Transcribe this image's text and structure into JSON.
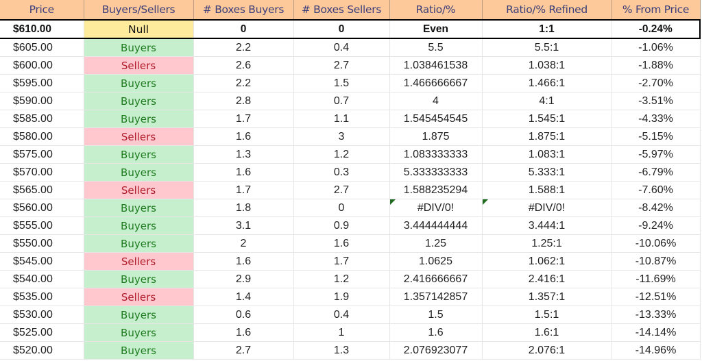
{
  "headers": [
    "Price",
    "Buyers/Sellers",
    "# Boxes Buyers",
    "# Boxes Sellers",
    "Ratio/%",
    "Ratio/% Refined",
    "% From Price"
  ],
  "colors": {
    "header_bg": "#fdc99a",
    "header_text": "#3d3f7a",
    "buyers_bg": "#c6efce",
    "buyers_text": "#1e7b1e",
    "sellers_bg": "#ffc7ce",
    "sellers_text": "#b01c2a",
    "null_bg": "#ffeb9c",
    "null_text": "#9c5a00"
  },
  "current_row": {
    "price": "$610.00",
    "side": "Null",
    "boxes_buyers": "0",
    "boxes_sellers": "0",
    "ratio": "Even",
    "ratio_refined": "1:1",
    "pct_from_price": "-0.24%"
  },
  "rows": [
    {
      "price": "$605.00",
      "side": "Buyers",
      "boxes_buyers": "2.2",
      "boxes_sellers": "0.4",
      "ratio": "5.5",
      "ratio_refined": "5.5:1",
      "pct_from_price": "-1.06%"
    },
    {
      "price": "$600.00",
      "side": "Sellers",
      "boxes_buyers": "2.6",
      "boxes_sellers": "2.7",
      "ratio": "1.038461538",
      "ratio_refined": "1.038:1",
      "pct_from_price": "-1.88%"
    },
    {
      "price": "$595.00",
      "side": "Buyers",
      "boxes_buyers": "2.2",
      "boxes_sellers": "1.5",
      "ratio": "1.466666667",
      "ratio_refined": "1.466:1",
      "pct_from_price": "-2.70%"
    },
    {
      "price": "$590.00",
      "side": "Buyers",
      "boxes_buyers": "2.8",
      "boxes_sellers": "0.7",
      "ratio": "4",
      "ratio_refined": "4:1",
      "pct_from_price": "-3.51%"
    },
    {
      "price": "$585.00",
      "side": "Buyers",
      "boxes_buyers": "1.7",
      "boxes_sellers": "1.1",
      "ratio": "1.545454545",
      "ratio_refined": "1.545:1",
      "pct_from_price": "-4.33%"
    },
    {
      "price": "$580.00",
      "side": "Sellers",
      "boxes_buyers": "1.6",
      "boxes_sellers": "3",
      "ratio": "1.875",
      "ratio_refined": "1.875:1",
      "pct_from_price": "-5.15%"
    },
    {
      "price": "$575.00",
      "side": "Buyers",
      "boxes_buyers": "1.3",
      "boxes_sellers": "1.2",
      "ratio": "1.083333333",
      "ratio_refined": "1.083:1",
      "pct_from_price": "-5.97%"
    },
    {
      "price": "$570.00",
      "side": "Buyers",
      "boxes_buyers": "1.6",
      "boxes_sellers": "0.3",
      "ratio": "5.333333333",
      "ratio_refined": "5.333:1",
      "pct_from_price": "-6.79%"
    },
    {
      "price": "$565.00",
      "side": "Sellers",
      "boxes_buyers": "1.7",
      "boxes_sellers": "2.7",
      "ratio": "1.588235294",
      "ratio_refined": "1.588:1",
      "pct_from_price": "-7.60%"
    },
    {
      "price": "$560.00",
      "side": "Buyers",
      "boxes_buyers": "1.8",
      "boxes_sellers": "0",
      "ratio": "#DIV/0!",
      "ratio_refined": "#DIV/0!",
      "pct_from_price": "-8.42%",
      "error_flag": true
    },
    {
      "price": "$555.00",
      "side": "Buyers",
      "boxes_buyers": "3.1",
      "boxes_sellers": "0.9",
      "ratio": "3.444444444",
      "ratio_refined": "3.444:1",
      "pct_from_price": "-9.24%"
    },
    {
      "price": "$550.00",
      "side": "Buyers",
      "boxes_buyers": "2",
      "boxes_sellers": "1.6",
      "ratio": "1.25",
      "ratio_refined": "1.25:1",
      "pct_from_price": "-10.06%"
    },
    {
      "price": "$545.00",
      "side": "Sellers",
      "boxes_buyers": "1.6",
      "boxes_sellers": "1.7",
      "ratio": "1.0625",
      "ratio_refined": "1.062:1",
      "pct_from_price": "-10.87%"
    },
    {
      "price": "$540.00",
      "side": "Buyers",
      "boxes_buyers": "2.9",
      "boxes_sellers": "1.2",
      "ratio": "2.416666667",
      "ratio_refined": "2.416:1",
      "pct_from_price": "-11.69%"
    },
    {
      "price": "$535.00",
      "side": "Sellers",
      "boxes_buyers": "1.4",
      "boxes_sellers": "1.9",
      "ratio": "1.357142857",
      "ratio_refined": "1.357:1",
      "pct_from_price": "-12.51%"
    },
    {
      "price": "$530.00",
      "side": "Buyers",
      "boxes_buyers": "0.6",
      "boxes_sellers": "0.4",
      "ratio": "1.5",
      "ratio_refined": "1.5:1",
      "pct_from_price": "-13.33%"
    },
    {
      "price": "$525.00",
      "side": "Buyers",
      "boxes_buyers": "1.6",
      "boxes_sellers": "1",
      "ratio": "1.6",
      "ratio_refined": "1.6:1",
      "pct_from_price": "-14.14%"
    },
    {
      "price": "$520.00",
      "side": "Buyers",
      "boxes_buyers": "2.7",
      "boxes_sellers": "1.3",
      "ratio": "2.076923077",
      "ratio_refined": "2.076:1",
      "pct_from_price": "-14.96%"
    }
  ]
}
